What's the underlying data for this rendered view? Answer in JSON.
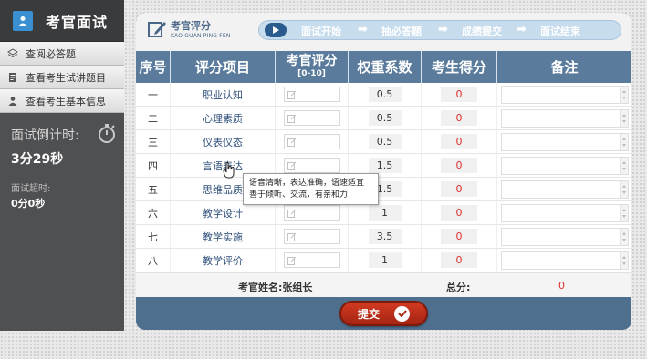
{
  "sidebar": {
    "title": "考官面试",
    "menu": [
      {
        "label": "查阅必答题",
        "icon": "layers-icon"
      },
      {
        "label": "查看考生试讲题目",
        "icon": "document-icon"
      },
      {
        "label": "查看考生基本信息",
        "icon": "user-icon"
      }
    ],
    "countdown_label": "面试倒计时:",
    "countdown_value": "3分29秒",
    "overtime_label": "面试超时:",
    "overtime_value": "0分0秒"
  },
  "brand": {
    "cn": "考官评分",
    "en": "KAO GUAN PING FEN"
  },
  "steps": [
    "面试开始",
    "抽必答题",
    "成绩提交",
    "面试结束"
  ],
  "table": {
    "headers": {
      "index": "序号",
      "item": "评分项目",
      "score": "考官评分",
      "score_range": "[0-10]",
      "weight": "权重系数",
      "got": "考生得分",
      "note": "备注"
    },
    "rows": [
      {
        "no": "一",
        "item": "职业认知",
        "weight": "0.5",
        "got": "0"
      },
      {
        "no": "二",
        "item": "心理素质",
        "weight": "0.5",
        "got": "0"
      },
      {
        "no": "三",
        "item": "仪表仪态",
        "weight": "0.5",
        "got": "0"
      },
      {
        "no": "四",
        "item": "言语表达",
        "weight": "1.5",
        "got": "0"
      },
      {
        "no": "五",
        "item": "思维品质",
        "weight": "1.5",
        "got": "0"
      },
      {
        "no": "六",
        "item": "教学设计",
        "weight": "1",
        "got": "0"
      },
      {
        "no": "七",
        "item": "教学实施",
        "weight": "3.5",
        "got": "0"
      },
      {
        "no": "八",
        "item": "教学评价",
        "weight": "1",
        "got": "0"
      }
    ]
  },
  "footer": {
    "examiner": "考官姓名:张组长",
    "total_label": "总分:",
    "total_value": "0"
  },
  "submit_label": "提交",
  "tooltip": {
    "line1": "语音清晰，表达准确，语速适宜",
    "line2": "善于倾听、交流，有亲和力"
  }
}
